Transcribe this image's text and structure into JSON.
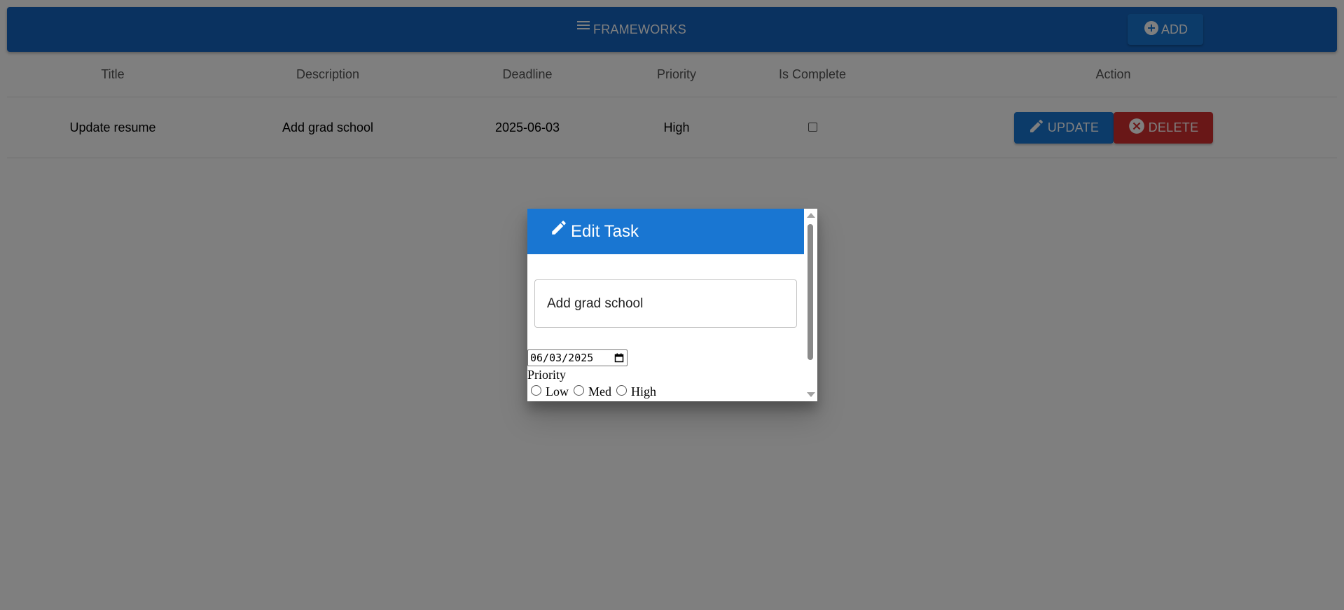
{
  "appbar": {
    "title": "FRAMEWORKS",
    "menu_icon": "menu-icon",
    "add_label": "ADD",
    "add_icon": "add-circle-icon",
    "color": "#1565c0"
  },
  "table": {
    "headers": {
      "title": "Title",
      "description": "Description",
      "deadline": "Deadline",
      "priority": "Priority",
      "is_complete": "Is Complete",
      "action": "Action"
    },
    "rows": [
      {
        "title": "Update resume",
        "description": "Add grad school",
        "deadline": "2025-06-03",
        "priority": "High",
        "is_complete": false,
        "update_label": "UPDATE",
        "delete_label": "DELETE"
      }
    ]
  },
  "dialog": {
    "title": "Edit Task",
    "title_icon": "pencil-icon",
    "description_value": "Add grad school",
    "date_value": "06/03/2025",
    "priority_label": "Priority",
    "priority_options": [
      "Low",
      "Med",
      "High"
    ],
    "priority_selected": null
  },
  "colors": {
    "primary": "#1976d2",
    "danger": "#d32f2f"
  }
}
